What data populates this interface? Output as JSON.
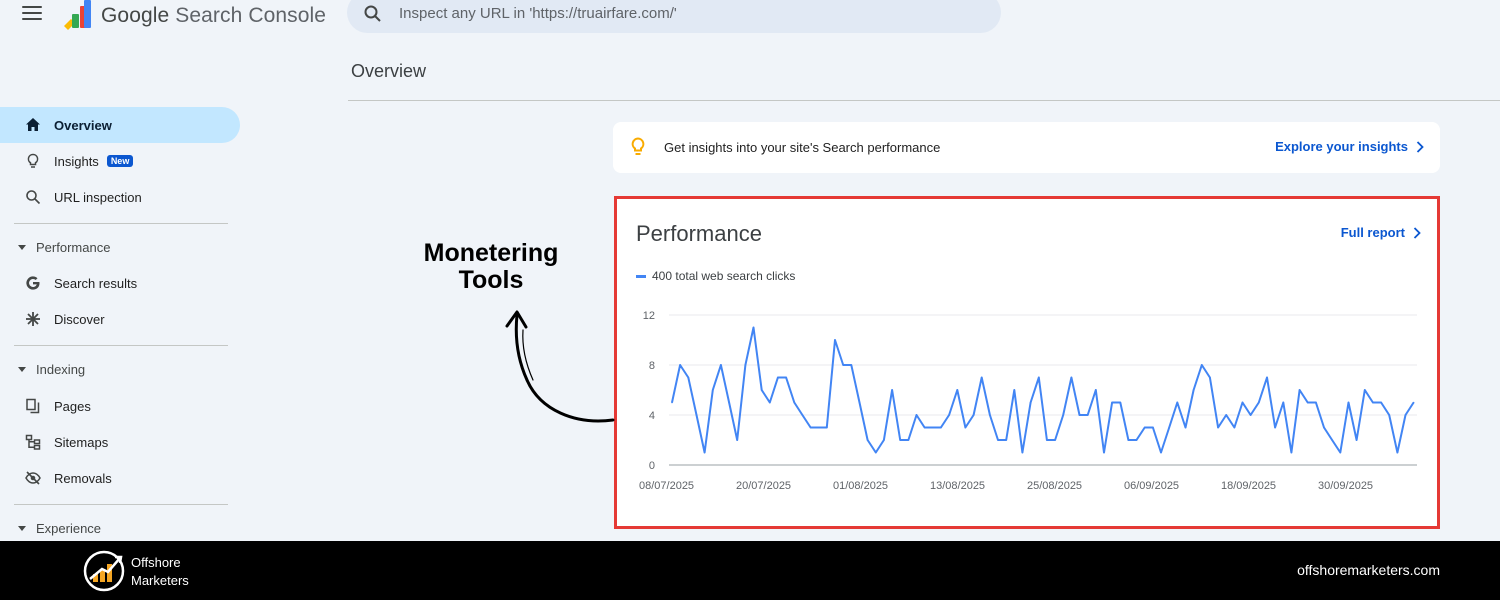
{
  "header": {
    "brand_google": "Google",
    "brand_product": "Search Console",
    "search_placeholder": "Inspect any URL in 'https://truairfare.com/'"
  },
  "page_title": "Overview",
  "sidebar": {
    "items": [
      {
        "label": "Overview",
        "icon": "home-icon",
        "active": true
      },
      {
        "label": "Insights",
        "icon": "lightbulb-icon",
        "badge": "New"
      },
      {
        "label": "URL inspection",
        "icon": "search-icon"
      }
    ],
    "sections": [
      {
        "label": "Performance",
        "items": [
          {
            "label": "Search results",
            "icon": "google-g-icon"
          },
          {
            "label": "Discover",
            "icon": "asterisk-icon"
          }
        ]
      },
      {
        "label": "Indexing",
        "items": [
          {
            "label": "Pages",
            "icon": "pages-icon"
          },
          {
            "label": "Sitemaps",
            "icon": "sitemap-icon"
          },
          {
            "label": "Removals",
            "icon": "eye-off-icon"
          }
        ]
      },
      {
        "label": "Experience",
        "items": []
      }
    ]
  },
  "insights_card": {
    "text": "Get insights into your site's Search performance",
    "link": "Explore your insights"
  },
  "performance_card": {
    "title": "Performance",
    "link": "Full report",
    "legend": "400 total web search clicks"
  },
  "annotation": {
    "line1": "Monetering",
    "line2": "Tools"
  },
  "footer": {
    "brand_line1": "Offshore",
    "brand_line2": "Marketers",
    "url": "offshoremarketers.com"
  },
  "colors": {
    "accent": "#0b57d0",
    "series": "#4285f4",
    "highlight_border": "#e53935",
    "active_nav": "#c2e7ff"
  },
  "chart_data": {
    "type": "line",
    "ylim": [
      0,
      12
    ],
    "yticks": [
      0,
      4,
      8,
      12
    ],
    "xtick_labels": [
      "08/07/2025",
      "20/07/2025",
      "01/08/2025",
      "13/08/2025",
      "25/08/2025",
      "06/09/2025",
      "18/09/2025",
      "30/09/2025"
    ],
    "grid": true,
    "series": [
      {
        "name": "400 total web search clicks",
        "color": "#4285f4",
        "values": [
          5,
          8,
          7,
          4,
          1,
          6,
          8,
          5,
          2,
          8,
          11,
          6,
          5,
          7,
          7,
          5,
          4,
          3,
          3,
          3,
          10,
          8,
          8,
          5,
          2,
          1,
          2,
          6,
          2,
          2,
          4,
          3,
          3,
          3,
          4,
          6,
          3,
          4,
          7,
          4,
          2,
          2,
          6,
          1,
          5,
          7,
          2,
          2,
          4,
          7,
          4,
          4,
          6,
          1,
          5,
          5,
          2,
          2,
          3,
          3,
          1,
          3,
          5,
          3,
          6,
          8,
          7,
          3,
          4,
          3,
          5,
          4,
          5,
          7,
          3,
          5,
          1,
          6,
          5,
          5,
          3,
          2,
          1,
          5,
          2,
          6,
          5,
          5,
          4,
          1,
          4,
          5
        ]
      }
    ]
  }
}
